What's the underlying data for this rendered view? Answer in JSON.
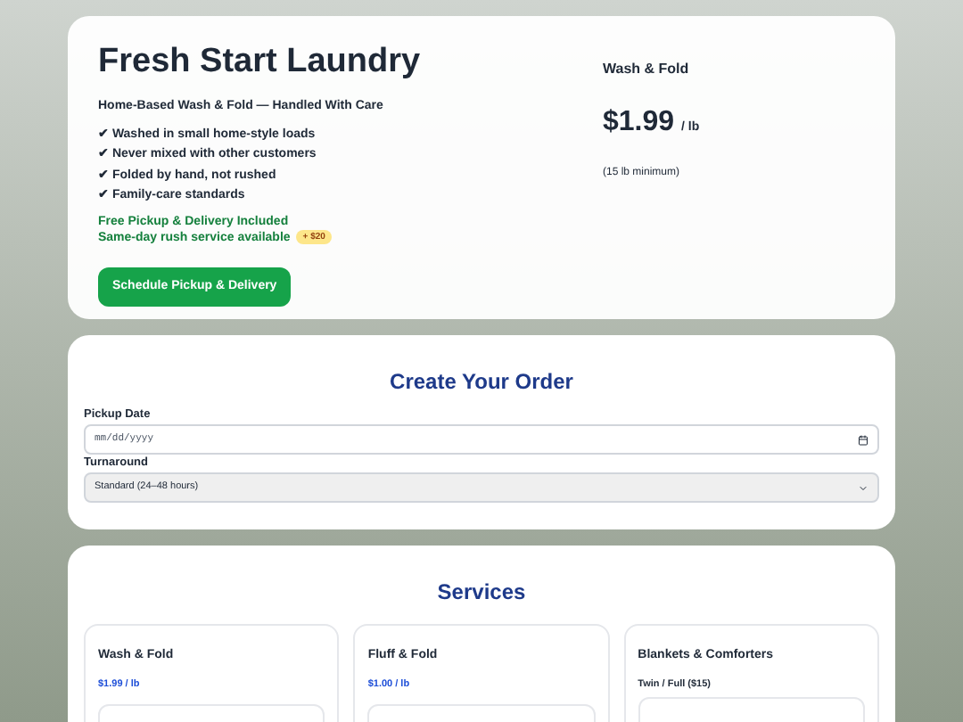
{
  "hero": {
    "title": "Fresh Start Laundry",
    "subtitle": "Home-Based Wash & Fold — Handled With Care",
    "features": [
      "✔ Washed in small home-style loads",
      "✔ Never mixed with other customers",
      "✔ Folded by hand, not rushed",
      "✔ Family-care standards"
    ],
    "delivery_note": "Free Pickup & Delivery Included",
    "rush_note": "Same-day rush service available",
    "rush_badge": "+ $20",
    "button": "Schedule Pickup & Delivery",
    "price_card": {
      "label": "Wash & Fold",
      "price": "$1.99",
      "unit": "/ lb",
      "note": "(15 lb minimum)"
    }
  },
  "order": {
    "title": "Create Your Order",
    "fields": [
      {
        "kind": "date",
        "label": "Pickup Date",
        "placeholder": "mm/dd/yyyy"
      },
      {
        "kind": "select",
        "label": "Turnaround",
        "value": "Standard (24–48 hours)"
      }
    ]
  },
  "services": {
    "title": "Services",
    "cards": [
      {
        "name": "Wash & Fold",
        "price": "$1.99 / lb"
      },
      {
        "name": "Fluff & Fold",
        "price": "$1.00 / lb"
      },
      {
        "name": "Blankets & Comforters",
        "option": "Twin / Full ($15)"
      }
    ]
  }
}
